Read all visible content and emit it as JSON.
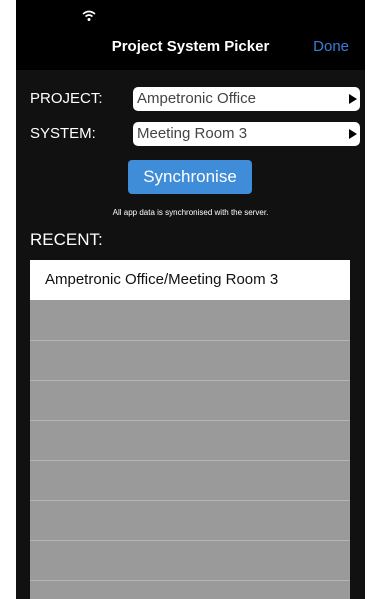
{
  "nav": {
    "title": "Project System Picker",
    "done_label": "Done"
  },
  "form": {
    "project_label": "PROJECT:",
    "project_value": "Ampetronic Office",
    "system_label": "SYSTEM:",
    "system_value": "Meeting Room 3"
  },
  "sync": {
    "button_label": "Synchronise",
    "note": "All app data is synchronised with the server."
  },
  "recent": {
    "heading": "RECENT:",
    "items": [
      "Ampetronic Office/Meeting Room 3"
    ]
  },
  "colors": {
    "accent": "#3f8cd9",
    "done": "#3a7fd5",
    "background": "#000000",
    "list_empty": "#9a9a9a"
  },
  "icons": {
    "status": "wifi-icon",
    "picker_arrow": "chevron-right-icon"
  }
}
